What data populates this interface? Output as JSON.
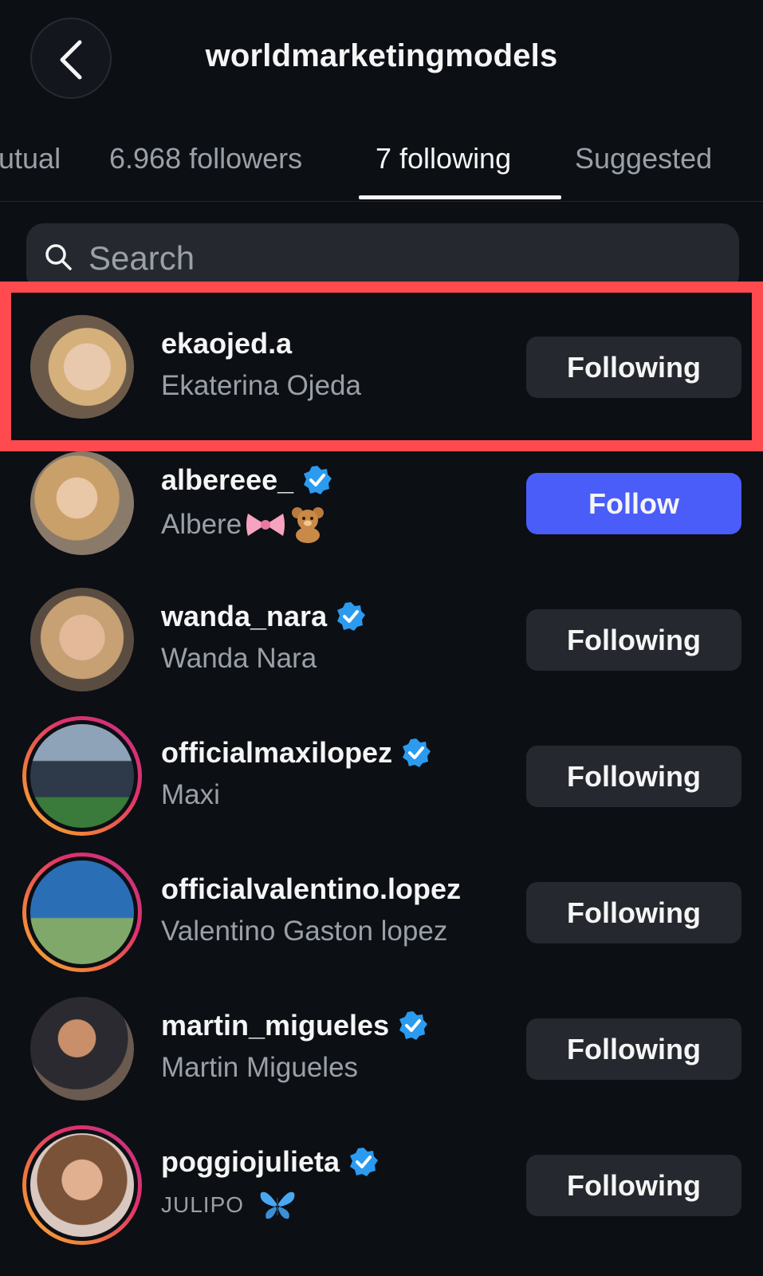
{
  "header": {
    "title": "worldmarketingmodels"
  },
  "tabs": [
    {
      "label": "utual"
    },
    {
      "label": "6.968 followers"
    },
    {
      "label": "7 following"
    },
    {
      "label": "Suggested"
    }
  ],
  "search": {
    "placeholder": "Search"
  },
  "colors": {
    "follow_button": "#4a5df9",
    "highlight": "#ff4a4f",
    "verified": "#2b9bf0"
  },
  "users": [
    {
      "username": "ekaojed.a",
      "fullname": "Ekaterina Ojeda",
      "button": "Following"
    },
    {
      "username": "albereee_",
      "fullname": "Albere",
      "button": "Follow"
    },
    {
      "username": "wanda_nara",
      "fullname": "Wanda Nara",
      "button": "Following"
    },
    {
      "username": "officialmaxilopez",
      "fullname": "Maxi",
      "button": "Following"
    },
    {
      "username": "officialvalentino.lopez",
      "fullname": "Valentino Gaston lopez",
      "button": "Following"
    },
    {
      "username": "martin_migueles",
      "fullname": "Martin Migueles",
      "button": "Following"
    },
    {
      "username": "poggiojulieta",
      "fullname": "JULIPO",
      "button": "Following"
    }
  ]
}
